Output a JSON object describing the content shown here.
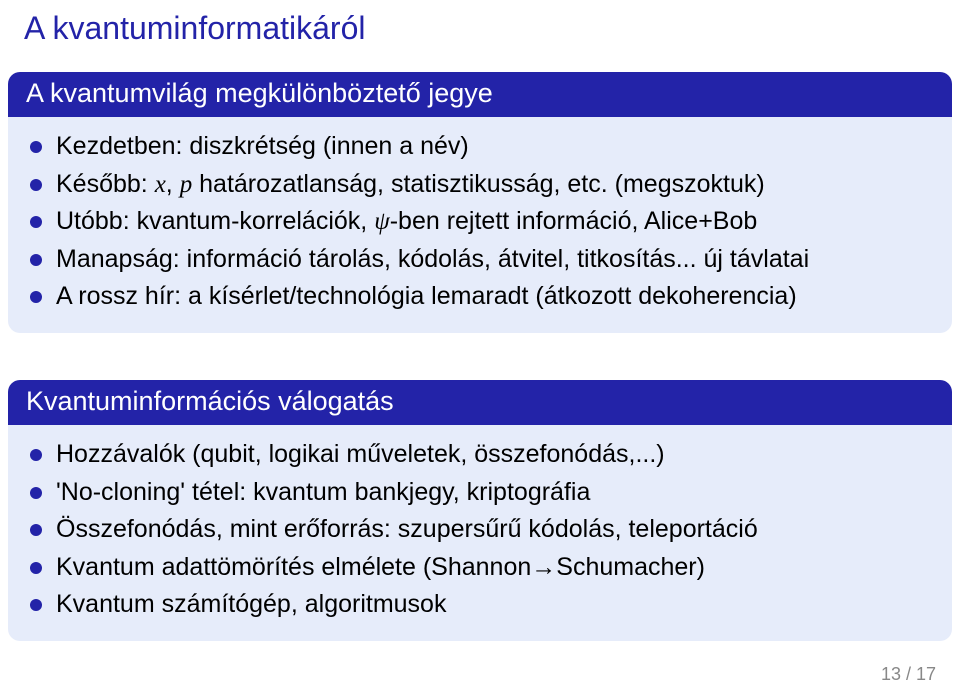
{
  "slide": {
    "title": "A kvantuminformatikáról",
    "block1": {
      "title": "A kvantumvilág megkülönböztető jegye",
      "items": [
        "Kezdetben: diszkrétség (innen a név)",
        "Később: x, p határozatlanság, statisztikusság, etc. (megszoktuk)",
        "Utóbb: kvantum-korrelációk, ψ-ben rejtett információ, Alice+Bob",
        "Manapság: információ tárolás, kódolás, átvitel, titkosítás... új távlatai",
        "A rossz hír: a kísérlet/technológia lemaradt (átkozott dekoherencia)"
      ]
    },
    "block2": {
      "title": "Kvantuminformációs válogatás",
      "items": [
        "Hozzávalók (qubit, logikai műveletek, összefonódás,...)",
        "'No-cloning' tétel: kvantum bankjegy, kriptográfia",
        "Összefonódás, mint erőforrás: szupersűrű kódolás, teleportáció",
        "Kvantum adattömörítés elmélete (Shannon→Schumacher)",
        "Kvantum számítógép, algoritmusok"
      ]
    },
    "page": "13 / 17"
  }
}
